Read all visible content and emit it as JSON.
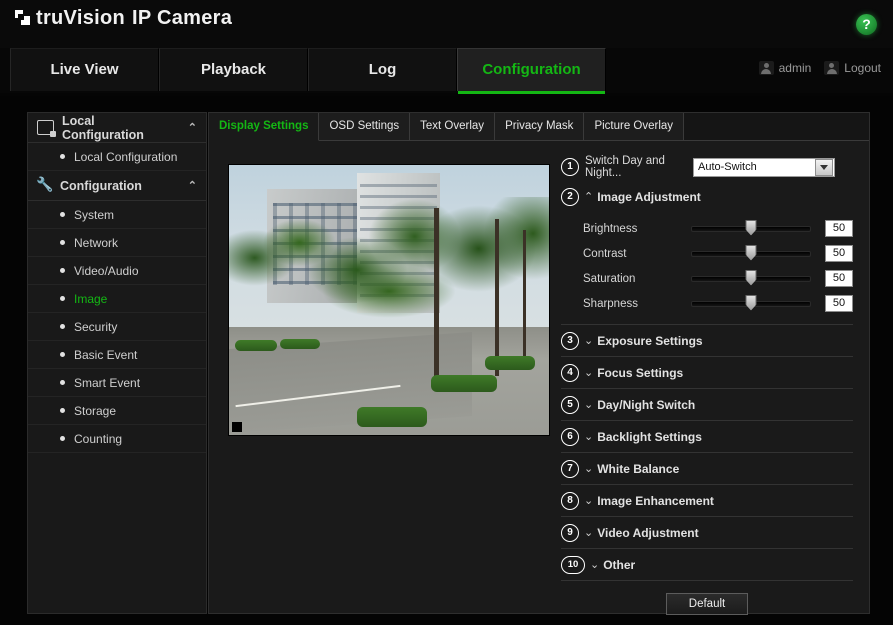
{
  "header": {
    "logo_icon": "truvision-logo-icon",
    "brand_primary": "truVision",
    "brand_secondary": "IP Camera",
    "help_icon": "help-question-icon",
    "help_label": "?"
  },
  "nav": {
    "tabs": [
      {
        "label": "Live View",
        "active": false
      },
      {
        "label": "Playback",
        "active": false
      },
      {
        "label": "Log",
        "active": false
      },
      {
        "label": "Configuration",
        "active": true
      }
    ],
    "user": {
      "icon": "user-icon",
      "label": "admin"
    },
    "logout": {
      "icon": "logout-user-icon",
      "label": "Logout"
    }
  },
  "sidebar": {
    "groups": [
      {
        "icon": "monitor-icon",
        "label": "Local Configuration",
        "chevron": "⌃",
        "items": [
          {
            "label": "Local Configuration",
            "active": false
          }
        ]
      },
      {
        "icon": "wrench-icon",
        "label": "Configuration",
        "chevron": "⌃",
        "items": [
          {
            "label": "System",
            "active": false
          },
          {
            "label": "Network",
            "active": false
          },
          {
            "label": "Video/Audio",
            "active": false
          },
          {
            "label": "Image",
            "active": true
          },
          {
            "label": "Security",
            "active": false
          },
          {
            "label": "Basic Event",
            "active": false
          },
          {
            "label": "Smart Event",
            "active": false
          },
          {
            "label": "Storage",
            "active": false
          },
          {
            "label": "Counting",
            "active": false
          }
        ]
      }
    ]
  },
  "content": {
    "tabs": [
      {
        "label": "Display Settings",
        "active": true
      },
      {
        "label": "OSD Settings",
        "active": false
      },
      {
        "label": "Text Overlay",
        "active": false
      },
      {
        "label": "Privacy Mask",
        "active": false
      },
      {
        "label": "Picture Overlay",
        "active": false
      }
    ],
    "video_preview": {
      "name": "live-video-preview",
      "description": "Street scene with apartment buildings, green trees and a road"
    },
    "switch_row": {
      "callout": "1",
      "label": "Switch Day and Night...",
      "dropdown_value": "Auto-Switch",
      "dropdown_icon": "chevron-down-icon"
    },
    "sections": [
      {
        "callout": "2",
        "label": "Image Adjustment",
        "chevron": "⌃",
        "expanded": true
      },
      {
        "callout": "3",
        "label": "Exposure Settings",
        "chevron": "⌄",
        "expanded": false
      },
      {
        "callout": "4",
        "label": "Focus Settings",
        "chevron": "⌄",
        "expanded": false
      },
      {
        "callout": "5",
        "label": "Day/Night Switch",
        "chevron": "⌄",
        "expanded": false
      },
      {
        "callout": "6",
        "label": "Backlight Settings",
        "chevron": "⌄",
        "expanded": false
      },
      {
        "callout": "7",
        "label": "White Balance",
        "chevron": "⌄",
        "expanded": false
      },
      {
        "callout": "8",
        "label": "Image Enhancement",
        "chevron": "⌄",
        "expanded": false
      },
      {
        "callout": "9",
        "label": "Video Adjustment",
        "chevron": "⌄",
        "expanded": false
      },
      {
        "callout": "10",
        "label": "Other",
        "chevron": "⌄",
        "expanded": false
      }
    ],
    "sliders": [
      {
        "label": "Brightness",
        "value": "50",
        "percent": 50
      },
      {
        "label": "Contrast",
        "value": "50",
        "percent": 50
      },
      {
        "label": "Saturation",
        "value": "50",
        "percent": 50
      },
      {
        "label": "Sharpness",
        "value": "50",
        "percent": 50
      }
    ],
    "default_button": "Default"
  },
  "colors": {
    "accent_green": "#14b714",
    "panel_bg": "#1a1a1a",
    "page_bg": "#050505",
    "text_primary": "#e6e6e6"
  }
}
